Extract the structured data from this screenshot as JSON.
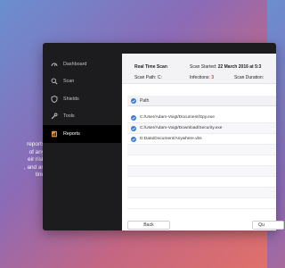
{
  "promo": {
    "lines": [
      "reports",
      "of any",
      "eir risk",
      ", and an",
      "tine"
    ]
  },
  "sidebar": {
    "items": [
      {
        "label": "Dashboard",
        "icon": "dashboard-icon",
        "active": false
      },
      {
        "label": "Scan",
        "icon": "search-icon",
        "active": false
      },
      {
        "label": "Shields",
        "icon": "shield-icon",
        "active": false
      },
      {
        "label": "Tools",
        "icon": "wrench-icon",
        "active": false
      },
      {
        "label": "Reports",
        "icon": "report-icon",
        "active": true
      }
    ]
  },
  "header": {
    "title": "Real Time Scan",
    "scan_path_label": "Scan Path:",
    "scan_path_value": "C:",
    "scan_started_label": "Scan Started:",
    "scan_started_value": "22 March 2016 at 5:3",
    "infections_label": "Infections:",
    "infections_value": "3",
    "scan_duration_label": "Scan Duration:"
  },
  "table": {
    "header": "Path",
    "rows": [
      "C:/User/Adam-Voigt/Document/Spy.exe",
      "C:/User/Adam-Voigt/Download/Security.exe",
      "D:Data/Document/Anywhere.vbs"
    ]
  },
  "buttons": {
    "back": "Back",
    "quarantine": "Qu"
  },
  "colors": {
    "accent": "#3a7bd5",
    "danger": "#e23a3a",
    "sidebar_bg": "#1c1c1e"
  }
}
